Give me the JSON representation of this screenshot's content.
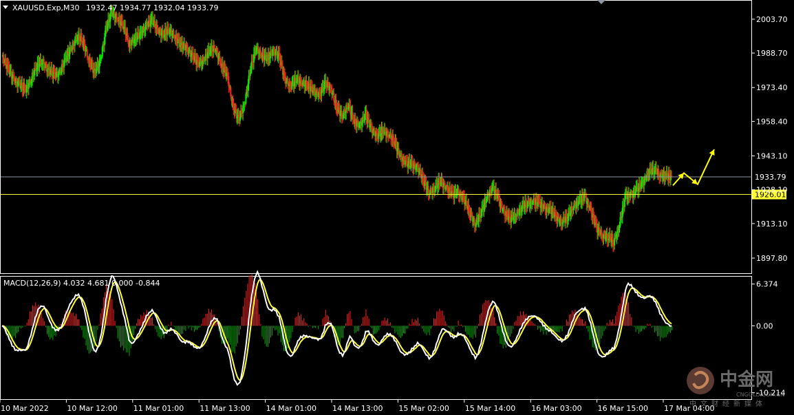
{
  "chart_data": [
    {
      "type": "candlestick",
      "title": "XAUUSD.Exp,M30",
      "ohlc_text": "1932.47 1934.77 1932.04 1933.79",
      "x_tick_labels": [
        "10 Mar 2022",
        "10 Mar 12:00",
        "11 Mar 01:00",
        "11 Mar 13:00",
        "14 Mar 01:00",
        "14 Mar 13:00",
        "15 Mar 02:00",
        "15 Mar 14:00",
        "16 Mar 03:00",
        "16 Mar 15:00",
        "17 Mar 04:00"
      ],
      "y_tick_labels": [
        "2003.70",
        "1988.70",
        "1973.40",
        "1958.40",
        "1943.10",
        "1928.10",
        "1913.10",
        "1897.80"
      ],
      "ylim": [
        1892.0,
        2011.0
      ],
      "price_line": {
        "label": "1933.79",
        "value": 1933.79,
        "color": "#8f97a3"
      },
      "level_line": {
        "label": "1926.01",
        "value": 1926.01,
        "color": "#ffff33"
      },
      "colors": {
        "bull": "#00ee00",
        "bear": "#ff2020",
        "annotation_arrow": "#ffff00"
      },
      "closes": [
        1987,
        1982,
        1977,
        1975,
        1972,
        1977,
        1983,
        1985,
        1981,
        1979,
        1980,
        1986,
        1991,
        1996,
        1994,
        1986,
        1980,
        1985,
        1999,
        2007,
        2004,
        2001,
        1993,
        1995,
        1997,
        2001,
        2003,
        1999,
        1997,
        1999,
        1996,
        1992,
        1991,
        1987,
        1984,
        1986,
        1990,
        1991,
        1983,
        1979,
        1965,
        1959,
        1966,
        1981,
        1991,
        1988,
        1986,
        1990,
        1987,
        1977,
        1974,
        1977,
        1976,
        1974,
        1972,
        1970,
        1975,
        1973,
        1964,
        1961,
        1966,
        1958,
        1957,
        1961,
        1955,
        1952,
        1954,
        1953,
        1949,
        1943,
        1940,
        1939,
        1938,
        1932,
        1927,
        1929,
        1932,
        1929,
        1926,
        1927,
        1924,
        1918,
        1913,
        1918,
        1925,
        1929,
        1924,
        1918,
        1915,
        1917,
        1920,
        1922,
        1923,
        1922,
        1920,
        1919,
        1916,
        1914,
        1916,
        1921,
        1923,
        1925,
        1919,
        1911,
        1908,
        1907,
        1905,
        1913,
        1925,
        1926,
        1928,
        1931,
        1936,
        1937,
        1935,
        1934,
        1933.79
      ],
      "macd_indicator": {
        "label": "MACD(12,26,9) 4.032 4.681 0.000 -0.844",
        "y_tick_labels": [
          "6.374",
          "0.00",
          "-10.214"
        ],
        "ylim": [
          -11.2,
          7.5
        ],
        "colors": {
          "macd": "#ffffff",
          "signal": "#ffff33",
          "hist_pos": "#ff2020",
          "hist_neg": "#00aa00"
        }
      }
    }
  ],
  "watermark": {
    "brand_cn": "中金网",
    "brand_en": "CNGOLD.COM.CN",
    "tagline_cn": "中文财经新媒体"
  },
  "icons": {
    "menu": "triangle-down-icon",
    "logo": "cngold-logo-icon",
    "scroll": "shift-marker-icon"
  }
}
